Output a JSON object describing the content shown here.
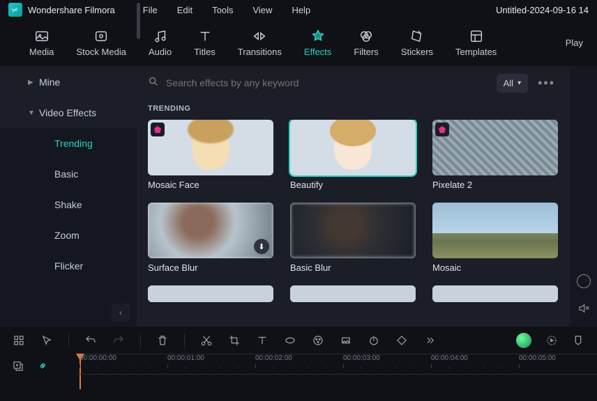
{
  "app": {
    "name": "Wondershare Filmora",
    "filename": "Untitled-2024-09-16 14"
  },
  "menu": {
    "items": [
      "File",
      "Edit",
      "Tools",
      "View",
      "Help"
    ]
  },
  "tools": {
    "items": [
      "Media",
      "Stock Media",
      "Audio",
      "Titles",
      "Transitions",
      "Effects",
      "Filters",
      "Stickers",
      "Templates"
    ],
    "active": "Effects",
    "right_label": "Play"
  },
  "sidebar": {
    "mine": "Mine",
    "video_effects": "Video Effects",
    "subs": [
      "Trending",
      "Basic",
      "Shake",
      "Zoom",
      "Flicker"
    ],
    "active_sub": "Trending"
  },
  "search": {
    "placeholder": "Search effects by any keyword",
    "filter_label": "All"
  },
  "content": {
    "section": "TRENDING",
    "cards": [
      {
        "label": "Mosaic Face",
        "premium": true
      },
      {
        "label": "Beautify",
        "premium": false,
        "selected": true
      },
      {
        "label": "Pixelate 2",
        "premium": true
      },
      {
        "label": "Surface Blur",
        "premium": true,
        "download": true
      },
      {
        "label": "Basic Blur",
        "premium": true
      },
      {
        "label": "Mosaic",
        "premium": false
      }
    ]
  },
  "timeline": {
    "marks": [
      "00:00:00:00",
      "00:00:01:00",
      "00:00:02:00",
      "00:00:03:00",
      "00:00:04:00",
      "00:00:05:00"
    ]
  }
}
